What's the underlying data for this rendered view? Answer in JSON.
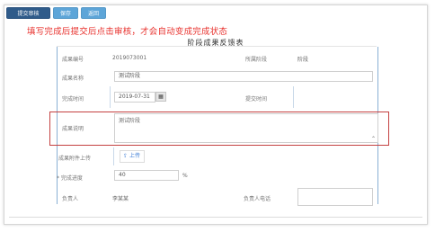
{
  "toolbar": {
    "buttons": [
      {
        "label": "提交审核"
      },
      {
        "label": "保存"
      },
      {
        "label": "返回"
      }
    ]
  },
  "tip_text": "填写完成后提交后点击审核，才会自动变成完成状态",
  "form_title": "阶段成果反馈表",
  "rows": {
    "code": {
      "label": "成果编号",
      "value": "2019073001",
      "right_label": "所属阶段",
      "right_value": "阶段"
    },
    "name": {
      "label": "成果名称",
      "value": "测试阶段"
    },
    "date": {
      "label": "完成时间",
      "value": "2019-07-31",
      "right_label": "提交时间"
    },
    "desc": {
      "label": "成果说明",
      "value": "测试阶段"
    },
    "attach": {
      "label": "成果附件上传",
      "button": "上传"
    },
    "progress": {
      "label": "* 完成进度",
      "value": "40",
      "unit": "%"
    },
    "person": {
      "label": "负责人",
      "value": "李某某",
      "right_label": "负责人电话"
    }
  },
  "icons": {
    "calendar": "calendar-icon",
    "resize": "resize-handle-icon",
    "upload": "upload-icon"
  },
  "colors": {
    "primary_button": "#2f5b8a",
    "secondary_button": "#5da5d8",
    "tip_text": "#e8322e",
    "highlight_box": "#c44141"
  }
}
